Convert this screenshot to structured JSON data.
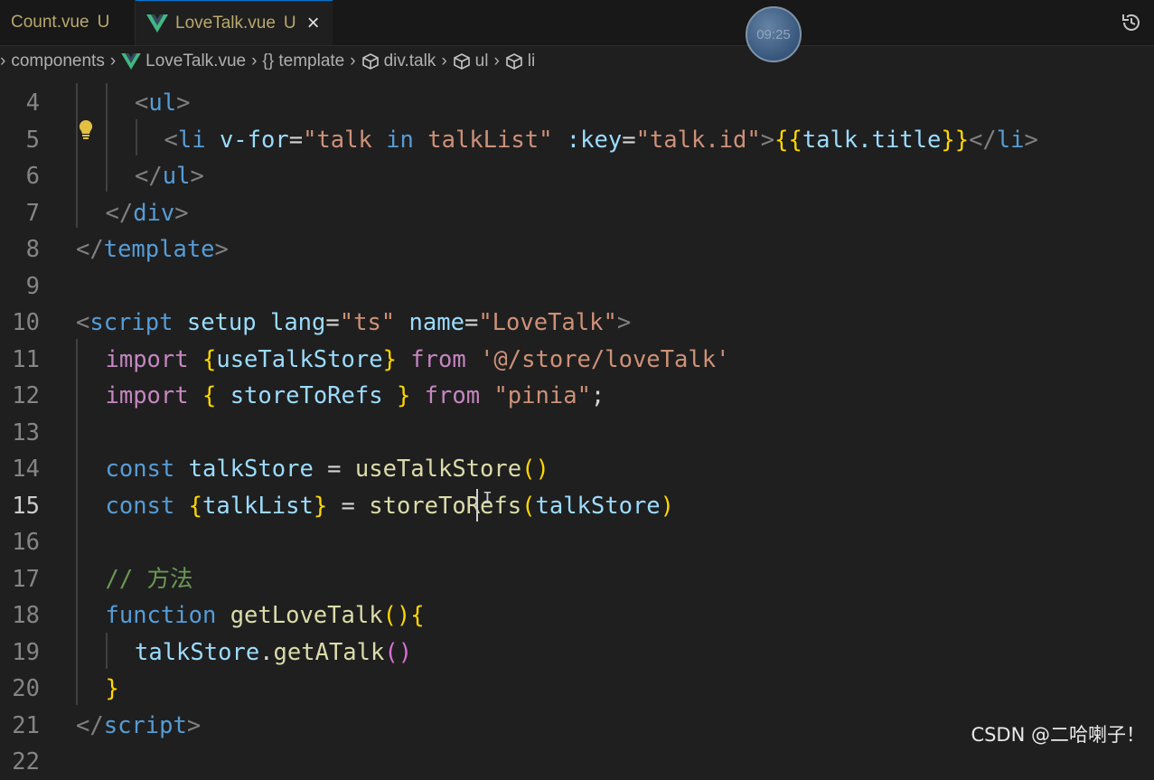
{
  "tabs": [
    {
      "label": "Count.vue",
      "status": "U",
      "active": false
    },
    {
      "label": "LoveTalk.vue",
      "status": "U",
      "active": true,
      "close": "×"
    }
  ],
  "overlay_clock": "09:25",
  "breadcrumb": {
    "items": [
      "components",
      "LoveTalk.vue",
      "{} template",
      "div.talk",
      "ul",
      "li"
    ]
  },
  "editor": {
    "current_line": 15,
    "lines": [
      {
        "n": "4",
        "tokens": [
          [
            "t-punct",
            "<"
          ],
          [
            "t-tag",
            "ul"
          ],
          [
            "t-punct",
            ">"
          ]
        ]
      },
      {
        "n": "5",
        "tokens": [
          [
            "t-punct",
            "<"
          ],
          [
            "t-tag",
            "li"
          ],
          [
            "t-txt",
            " "
          ],
          [
            "t-attr",
            "v-for"
          ],
          [
            "t-txt",
            "="
          ],
          [
            "t-str",
            "\"talk "
          ],
          [
            "t-in",
            "in"
          ],
          [
            "t-str",
            " talkList\""
          ],
          [
            "t-txt",
            " "
          ],
          [
            "t-attr",
            ":key"
          ],
          [
            "t-txt",
            "="
          ],
          [
            "t-str",
            "\"talk.id\""
          ],
          [
            "t-punct",
            ">"
          ],
          [
            "t-br1",
            "{{"
          ],
          [
            "t-var",
            "talk.title"
          ],
          [
            "t-br1",
            "}}"
          ],
          [
            "t-punct",
            "</"
          ],
          [
            "t-tag",
            "li"
          ],
          [
            "t-punct",
            ">"
          ]
        ]
      },
      {
        "n": "6",
        "tokens": [
          [
            "t-punct",
            "</"
          ],
          [
            "t-tag",
            "ul"
          ],
          [
            "t-punct",
            ">"
          ]
        ]
      },
      {
        "n": "7",
        "tokens": [
          [
            "t-punct",
            "</"
          ],
          [
            "t-tag",
            "div"
          ],
          [
            "t-punct",
            ">"
          ]
        ]
      },
      {
        "n": "8",
        "tokens": [
          [
            "t-punct",
            "</"
          ],
          [
            "t-tag",
            "template"
          ],
          [
            "t-punct",
            ">"
          ]
        ]
      },
      {
        "n": "9",
        "tokens": []
      },
      {
        "n": "10",
        "tokens": [
          [
            "t-punct",
            "<"
          ],
          [
            "t-tag",
            "script"
          ],
          [
            "t-txt",
            " "
          ],
          [
            "t-attr",
            "setup"
          ],
          [
            "t-txt",
            " "
          ],
          [
            "t-attr",
            "lang"
          ],
          [
            "t-txt",
            "="
          ],
          [
            "t-str",
            "\"ts\""
          ],
          [
            "t-txt",
            " "
          ],
          [
            "t-attr",
            "name"
          ],
          [
            "t-txt",
            "="
          ],
          [
            "t-str",
            "\"LoveTalk\""
          ],
          [
            "t-punct",
            ">"
          ]
        ]
      },
      {
        "n": "11",
        "tokens": [
          [
            "t-kw",
            "import"
          ],
          [
            "t-txt",
            " "
          ],
          [
            "t-br1",
            "{"
          ],
          [
            "t-var",
            "useTalkStore"
          ],
          [
            "t-br1",
            "}"
          ],
          [
            "t-txt",
            " "
          ],
          [
            "t-kw",
            "from"
          ],
          [
            "t-txt",
            " "
          ],
          [
            "t-str",
            "'@/store/loveTalk'"
          ]
        ]
      },
      {
        "n": "12",
        "tokens": [
          [
            "t-kw",
            "import"
          ],
          [
            "t-txt",
            " "
          ],
          [
            "t-br1",
            "{"
          ],
          [
            "t-txt",
            " "
          ],
          [
            "t-var",
            "storeToRefs"
          ],
          [
            "t-txt",
            " "
          ],
          [
            "t-br1",
            "}"
          ],
          [
            "t-txt",
            " "
          ],
          [
            "t-kw",
            "from"
          ],
          [
            "t-txt",
            " "
          ],
          [
            "t-str",
            "\"pinia\""
          ],
          [
            "t-txt",
            ";"
          ]
        ]
      },
      {
        "n": "13",
        "tokens": []
      },
      {
        "n": "14",
        "tokens": [
          [
            "t-decl",
            "const"
          ],
          [
            "t-txt",
            " "
          ],
          [
            "t-var",
            "talkStore"
          ],
          [
            "t-txt",
            " = "
          ],
          [
            "t-fn",
            "useTalkStore"
          ],
          [
            "t-br1",
            "()"
          ]
        ]
      },
      {
        "n": "15",
        "tokens": [
          [
            "t-decl",
            "const"
          ],
          [
            "t-txt",
            " "
          ],
          [
            "t-br1",
            "{"
          ],
          [
            "t-var",
            "talkList"
          ],
          [
            "t-br1",
            "}"
          ],
          [
            "t-txt",
            " = "
          ],
          [
            "t-fn",
            "storeToRefs"
          ],
          [
            "t-br1",
            "("
          ],
          [
            "t-var",
            "talkStore"
          ],
          [
            "t-br1",
            ")"
          ]
        ]
      },
      {
        "n": "16",
        "tokens": []
      },
      {
        "n": "17",
        "tokens": [
          [
            "t-cmt",
            "// 方法"
          ]
        ]
      },
      {
        "n": "18",
        "tokens": [
          [
            "t-decl",
            "function"
          ],
          [
            "t-txt",
            " "
          ],
          [
            "t-fn",
            "getLoveTalk"
          ],
          [
            "t-br1",
            "(){"
          ]
        ]
      },
      {
        "n": "19",
        "tokens": [
          [
            "t-var",
            "talkStore"
          ],
          [
            "t-txt",
            "."
          ],
          [
            "t-fn",
            "getATalk"
          ],
          [
            "t-br2",
            "()"
          ]
        ]
      },
      {
        "n": "20",
        "tokens": [
          [
            "t-br1",
            "}"
          ]
        ]
      },
      {
        "n": "21",
        "tokens": [
          [
            "t-punct",
            "</"
          ],
          [
            "t-tag",
            "script"
          ],
          [
            "t-punct",
            ">"
          ]
        ]
      },
      {
        "n": "22",
        "tokens": []
      }
    ]
  },
  "watermark": "CSDN @二哈喇子！",
  "icons": [
    "vue-logo-icon",
    "close-icon",
    "history-icon",
    "chevron-right-icon",
    "symbol-cube-icon",
    "lightbulb-icon"
  ]
}
